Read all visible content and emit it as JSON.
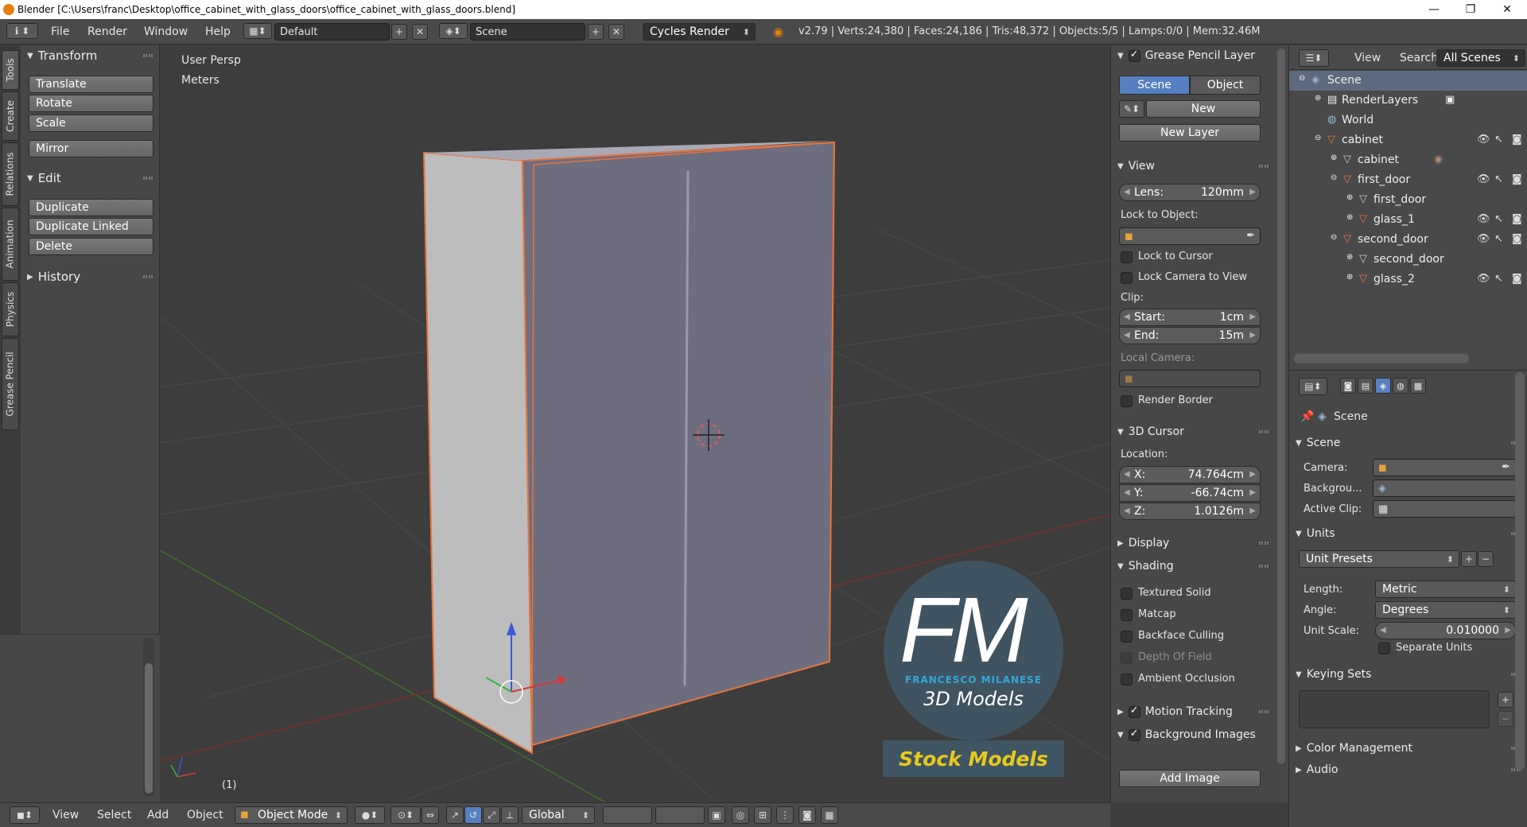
{
  "window": {
    "title": "Blender [C:\\Users\\franc\\Desktop\\office_cabinet_with_glass_doors\\office_cabinet_with_glass_doors.blend]",
    "minimize": "—",
    "maximize": "❐",
    "close": "✕"
  },
  "info_header": {
    "menus": [
      "File",
      "Render",
      "Window",
      "Help"
    ],
    "layout": "Default",
    "scene": "Scene",
    "engine": "Cycles Render",
    "stats": "v2.79 | Verts:24,380 | Faces:24,186 | Tris:48,372 | Objects:5/5 | Lamps:0/0 | Mem:32.46M"
  },
  "side_tabs": [
    "Tools",
    "Create",
    "Relations",
    "Animation",
    "Physics",
    "Grease Pencil"
  ],
  "toolshelf": {
    "transform": {
      "title": "Transform",
      "buttons": [
        "Translate",
        "Rotate",
        "Scale",
        "Mirror"
      ]
    },
    "edit": {
      "title": "Edit",
      "buttons": [
        "Duplicate",
        "Duplicate Linked",
        "Delete"
      ]
    },
    "history": {
      "title": "History"
    }
  },
  "viewport": {
    "view_name": "User Persp",
    "units": "Meters",
    "frame": "(1)",
    "watermark": {
      "letters": "FM",
      "name": "FRANCESCO MILANESE",
      "subtitle": "3D Models",
      "banner": "Stock Models"
    }
  },
  "bottom_header": {
    "menus": [
      "View",
      "Select",
      "Add",
      "Object"
    ],
    "mode": "Object Mode",
    "orientation": "Global"
  },
  "npanel": {
    "grease_pencil": {
      "title": "Grease Pencil Layer",
      "tab_scene": "Scene",
      "tab_object": "Object",
      "new": "New",
      "new_layer": "New Layer"
    },
    "view": {
      "title": "View",
      "lens_label": "Lens:",
      "lens_value": "120mm",
      "lock_object": "Lock to Object:",
      "lock_cursor": "Lock to Cursor",
      "lock_camera": "Lock Camera to View",
      "clip": "Clip:",
      "start_label": "Start:",
      "start_value": "1cm",
      "end_label": "End:",
      "end_value": "15m",
      "local_camera": "Local Camera:",
      "render_border": "Render Border"
    },
    "cursor": {
      "title": "3D Cursor",
      "location": "Location:",
      "x_label": "X:",
      "x_value": "74.764cm",
      "y_label": "Y:",
      "y_value": "-66.74cm",
      "z_label": "Z:",
      "z_value": "1.0126m"
    },
    "display": {
      "title": "Display"
    },
    "shading": {
      "title": "Shading",
      "items": [
        "Textured Solid",
        "Matcap",
        "Backface Culling",
        "Depth Of Field",
        "Ambient Occlusion"
      ]
    },
    "motion_tracking": {
      "title": "Motion Tracking"
    },
    "bg_images": {
      "title": "Background Images",
      "add": "Add Image"
    }
  },
  "outliner": {
    "menus": [
      "View",
      "Search"
    ],
    "filter": "All Scenes",
    "rows": [
      "Scene",
      "RenderLayers",
      "World",
      "cabinet",
      "cabinet",
      "first_door",
      "first_door",
      "glass_1",
      "second_door",
      "second_door",
      "glass_2"
    ]
  },
  "properties": {
    "context": "Scene",
    "scene_panel": {
      "title": "Scene",
      "camera": "Camera:",
      "background": "Backgrou...",
      "active_clip": "Active Clip:"
    },
    "units": {
      "title": "Units",
      "presets": "Unit Presets",
      "length_label": "Length:",
      "length_value": "Metric",
      "angle_label": "Angle:",
      "angle_value": "Degrees",
      "scale_label": "Unit Scale:",
      "scale_value": "0.010000",
      "separate": "Separate Units"
    },
    "keying": {
      "title": "Keying Sets"
    },
    "color_management": {
      "title": "Color Management"
    },
    "audio": {
      "title": "Audio"
    }
  },
  "colors": {
    "accent": "#5680c2",
    "selection": "#e8743b",
    "orange_icon": "#e87d0d"
  }
}
